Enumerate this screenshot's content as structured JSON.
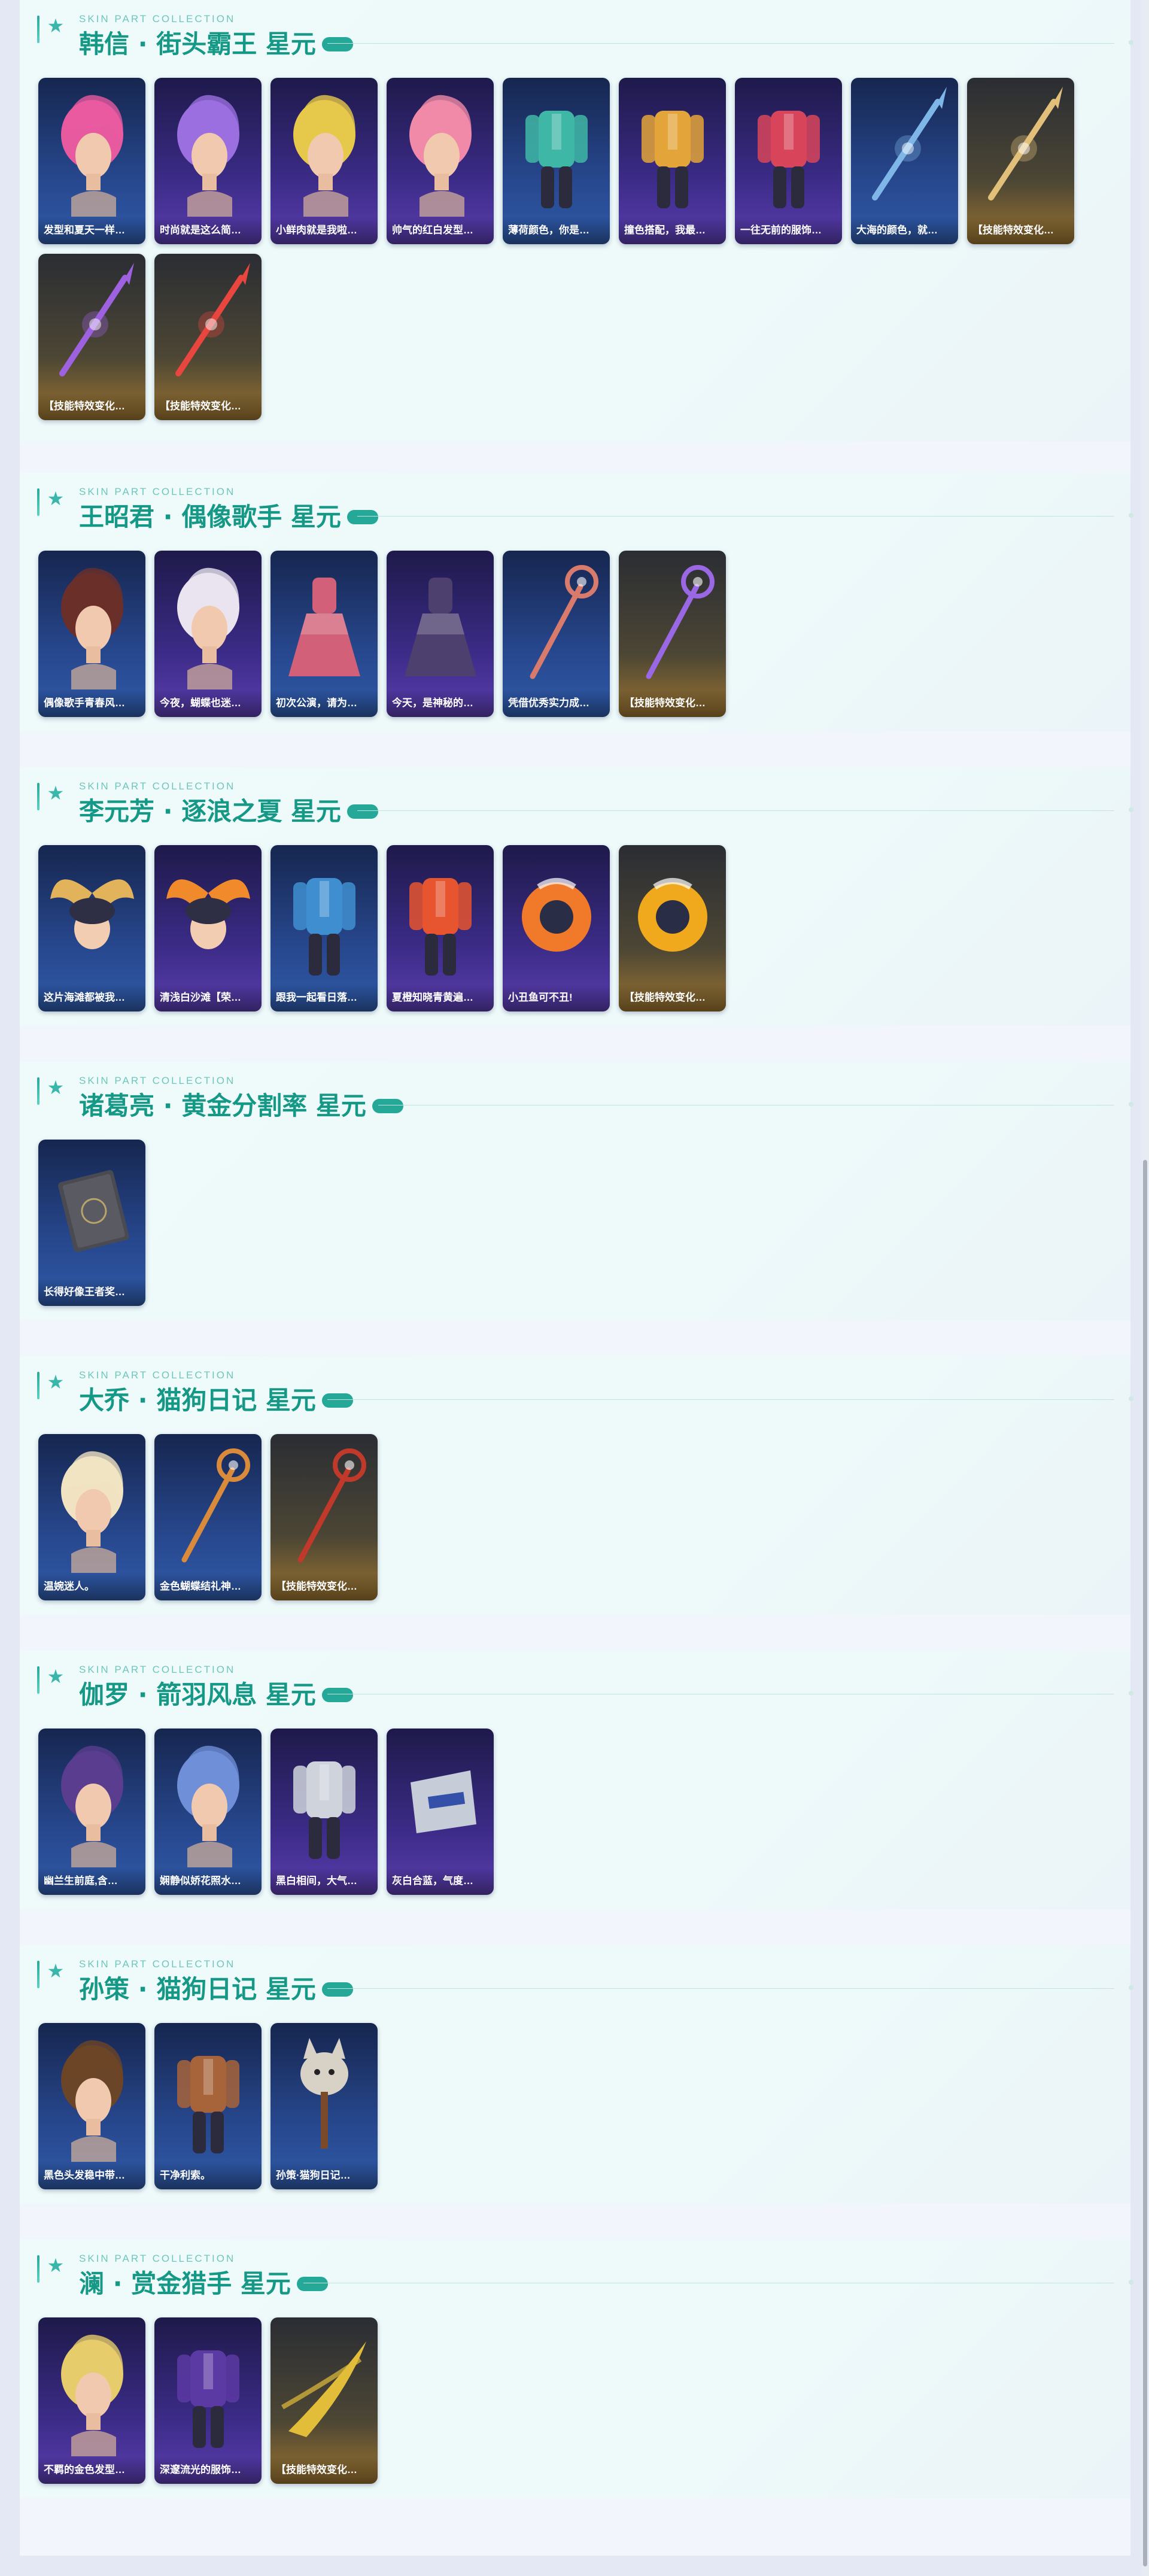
{
  "section_label": "SKIN PART COLLECTION",
  "colors": {
    "title": "#159885",
    "accent": "#25a897",
    "blue_card": "#27478d",
    "purple_card": "#3b2b86",
    "gold_card": "#9b7431"
  },
  "sections": [
    {
      "title": "韩信 · 街头霸王 星元",
      "items": [
        {
          "label": "发型和夏天一样…",
          "theme": "blue",
          "art": "hair-icon",
          "color": "#e85aa0"
        },
        {
          "label": "时尚就是这么简…",
          "theme": "purple",
          "art": "hair-icon",
          "color": "#9b6fe0"
        },
        {
          "label": "小鲜肉就是我啦…",
          "theme": "purple",
          "art": "hair-icon",
          "color": "#e6c84a"
        },
        {
          "label": "帅气的红白发型…",
          "theme": "purple",
          "art": "hair-icon",
          "color": "#f08aa8"
        },
        {
          "label": "薄荷颜色，你是…",
          "theme": "blue",
          "art": "outfit-icon",
          "color": "#3fb7a6"
        },
        {
          "label": "撞色搭配，我最…",
          "theme": "purple",
          "art": "outfit-icon",
          "color": "#e3a53a"
        },
        {
          "label": "一往无前的服饰…",
          "theme": "purple",
          "art": "outfit-icon",
          "color": "#d8455a"
        },
        {
          "label": "大海的颜色，就…",
          "theme": "blue",
          "art": "spear-icon",
          "color": "#7fb6e8"
        },
        {
          "label": "【技能特效变化…",
          "theme": "gold",
          "art": "spear-icon",
          "color": "#e2c07a"
        },
        {
          "label": "【技能特效变化…",
          "theme": "gold",
          "art": "spear-icon",
          "color": "#9e62e0"
        },
        {
          "label": "【技能特效变化…",
          "theme": "gold",
          "art": "spear-icon",
          "color": "#e8463f"
        }
      ]
    },
    {
      "title": "王昭君 · 偶像歌手 星元",
      "items": [
        {
          "label": "偶像歌手青春风…",
          "theme": "blue",
          "art": "hair-icon",
          "color": "#6b2f2a"
        },
        {
          "label": "今夜，蝴蝶也迷…",
          "theme": "purple",
          "art": "hair-icon",
          "color": "#e9e4ef"
        },
        {
          "label": "初次公演，请为…",
          "theme": "blue",
          "art": "dress-icon",
          "color": "#d26078"
        },
        {
          "label": "今天，是神秘的…",
          "theme": "purple",
          "art": "dress-icon",
          "color": "#4d3f6e"
        },
        {
          "label": "凭借优秀实力成…",
          "theme": "blue",
          "art": "staff-icon",
          "color": "#d97b6c"
        },
        {
          "label": "【技能特效变化…",
          "theme": "gold",
          "art": "staff-icon",
          "color": "#9a68e4"
        }
      ]
    },
    {
      "title": "李元芳 · 逐浪之夏 星元",
      "items": [
        {
          "label": "这片海滩都被我…",
          "theme": "blue",
          "art": "wings-icon",
          "color": "#e2b35a"
        },
        {
          "label": "清浅白沙滩【荣…",
          "theme": "purple",
          "art": "wings-icon",
          "color": "#f08a2a"
        },
        {
          "label": "跟我一起看日落…",
          "theme": "blue",
          "art": "outfit-icon",
          "color": "#3f8fd0"
        },
        {
          "label": "夏橙知晓青黄遍…",
          "theme": "purple",
          "art": "outfit-icon",
          "color": "#e6552f"
        },
        {
          "label": "小丑鱼可不丑!",
          "theme": "purple",
          "art": "ring-icon",
          "color": "#f07a2a"
        },
        {
          "label": "【技能特效变化…",
          "theme": "gold",
          "art": "ring-icon",
          "color": "#f0a81c"
        }
      ]
    },
    {
      "title": "诸葛亮 · 黄金分割率 星元",
      "items": [
        {
          "label": "长得好像王者奖…",
          "theme": "blue",
          "art": "book-icon",
          "color": "#4a4a52"
        }
      ]
    },
    {
      "title": "大乔 · 猫狗日记 星元",
      "items": [
        {
          "label": "温婉迷人。",
          "theme": "blue",
          "art": "hair-icon",
          "color": "#f1e3c2"
        },
        {
          "label": "金色蝴蝶结礼神…",
          "theme": "blue",
          "art": "staff-icon",
          "color": "#d98a3a"
        },
        {
          "label": "【技能特效变化…",
          "theme": "gold",
          "art": "staff-icon",
          "color": "#c0392b"
        }
      ]
    },
    {
      "title": "伽罗 · 箭羽风息 星元",
      "items": [
        {
          "label": "幽兰生前庭,含…",
          "theme": "blue",
          "art": "hair-icon",
          "color": "#5a3d8f"
        },
        {
          "label": "娴静似娇花照水…",
          "theme": "blue",
          "art": "hair-icon",
          "color": "#6f8fd8"
        },
        {
          "label": "黑白相间，大气…",
          "theme": "purple",
          "art": "outfit-icon",
          "color": "#cfd3dc"
        },
        {
          "label": "灰白合蓝，气度…",
          "theme": "purple",
          "art": "bracer-icon",
          "color": "#c6ccd8"
        }
      ]
    },
    {
      "title": "孙策 · 猫狗日记 星元",
      "items": [
        {
          "label": "黑色头发稳中带…",
          "theme": "blue",
          "art": "hair-icon",
          "color": "#6b4527"
        },
        {
          "label": "干净利索。",
          "theme": "blue",
          "art": "outfit-icon",
          "color": "#a7643a"
        },
        {
          "label": "孙策·猫狗日记…",
          "theme": "blue",
          "art": "dog-icon",
          "color": "#d8d2c6"
        }
      ]
    },
    {
      "title": "澜 · 赏金猎手 星元",
      "items": [
        {
          "label": "不羁的金色发型…",
          "theme": "purple",
          "art": "hair-icon",
          "color": "#e6cc6a"
        },
        {
          "label": "深邃流光的服饰…",
          "theme": "purple",
          "art": "outfit-icon",
          "color": "#5c3aa3"
        },
        {
          "label": "【技能特效变化…",
          "theme": "gold",
          "art": "blade-icon",
          "color": "#e2bd3a"
        }
      ]
    }
  ]
}
